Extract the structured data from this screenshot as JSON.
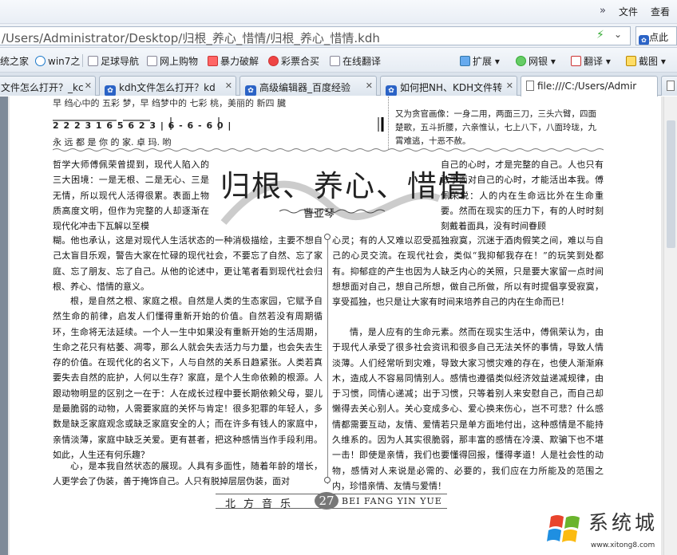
{
  "topbar": {
    "chevron": "»",
    "menu_file": "文件",
    "menu_view": "查看"
  },
  "address": {
    "url": "/Users/Administrator/Desktop/归根_养心_惜情/归根_养心_惜情.kdh",
    "search": "点此"
  },
  "bookmarks": [
    {
      "label": "统之家"
    },
    {
      "label": "win7之"
    },
    {
      "label": "足球导航"
    },
    {
      "label": "网上购物"
    },
    {
      "label": "暴力破解"
    },
    {
      "label": "彩票合买"
    },
    {
      "label": "在线翻译"
    }
  ],
  "tools": {
    "ext": "扩展",
    "bank": "网银",
    "translate": "翻译",
    "screenshot": "截图"
  },
  "tabs": [
    {
      "label": "文件怎么打开？_kc"
    },
    {
      "label": "kdh文件怎么打开？kd"
    },
    {
      "label": "高级编辑器_百度经验"
    },
    {
      "label": "如何把NH、KDH文件转"
    },
    {
      "label": "file:///C:/Users/Admir"
    }
  ],
  "article": {
    "score_cut": "早  绉心中的 五彩    梦，早 绉梦中的 七彩  桃，美丽的 新四  臓",
    "score_notes": "2 2 2 3  1 6 5   6 2 3  | 6 -  6 -  6 0 |",
    "score_lyrics": "永 远 都 是 你      的    家. 卓 玛.   哟",
    "topright_text": "又为贪官画像：一身二用，两面三刀，三头六臂，四面楚歌，五斗折腰，六亲惟认，七上八下，八面玲珑，九霄难逃，十恶不赦。",
    "title": "归根、养心、惜情",
    "author": "曹亚琴",
    "left_top": "哲学大师傅佩荣曾提到，现代人陷入的三大困境：一是无根、二是无心、三是无情，所以现代人活得很累。表面上物质高度文明，但作为完整的人却逐渐在现代化冲击下瓦解以至模",
    "left_main": "糊。他也承认，这是对现代人生活状态的一种消极描绘，主要不想自己太盲目乐观，警告大家在忙碌的现代社会，不要忘了自然、忘了家庭、忘了朋友、忘了自己。从他的论述中，更让笔者看到现代社会归根、养心、惜情的意义。",
    "left_p2": "根，是自然之根、家庭之根。自然是人类的生态家园，它赋予自然生命的前律，启发人们懂得重新开始的价值。自然若没有周期循环，生命将无法延续。一个人一生中如果没有重新开始的生活周期，生命之花只有枯萎、凋零，那么人就会失去活力与力量，也会失去生存的价值。在现代化的名义下，人与自然的关系日趋紧张。人类若真要失去自然的庇护，人何以生存？家庭，是个人生命依赖的根源。人跟动物明显的区别之一在于：人在成长过程中要长期依赖父母，婴儿是最脆弱的动物，人需要家庭的关怀与肯定！很多犯罪的年轻人，多数是缺乏家庭观念或缺乏家庭安全的人；而在许多有钱人的家庭中，亲情淡薄，家庭中缺乏关爱。更有甚者，把这种感情当作手段利用。如此，人生还有何乐趣？",
    "left_p3": "心，是本我自然状态的展现。人具有多面性，随着年龄的增长，人更学会了伪装，善于掩饰自己。人只有脱掉层层伪装，面对",
    "right_top": "自己的心时，才是完整的自己。人也只有敢于面对自己的心时，才能活出本我。傅佩荣说：人的内在生命远比外在生命重要。然而在现实的压力下，有的人时时刻刻戴着面具，没有时间眷顾",
    "right_main": "心灵；有的人又难以忍受孤独寂寞，沉迷于酒肉假笑之间，难以与自己的心灵交流。在现代社会，类似“我抑郁我存在！”的玩笑到处都有。抑郁症的产生也因为人缺乏内心的关照，只是要大家留一点时间想想面对自己，想自己所想，做自己所做，所以有时提倡享受寂寞，享受孤独，也只是让大家有时间来培养自己的内在生命而已！",
    "right_p2": "情，是人应有的生命元素。然而在现实生活中，傅佩荣认为，由于现代人承受了很多社会资讯和很多自己无法关怀的事情，导致人情淡薄。人们经常听到灾难，导致大家习惯灾难的存在，也使人渐渐麻木，造成人不容易同情别人。感情也遵循类似经济效益递减规律，由于习惯，同情心递减；出于习惯，只等着别人来安慰自己，而自己却懒得去关心别人。关心变成多心、爱心换来伤心，岂不可悲？什么感情都需要互动，友情、爱情若只是单方面地付出，这种感情是不能持久维系的。因为人其实很脆弱，那丰富的感情在冷漠、欺骗下也不堪一击！即使是亲情，我们也要懂得回报，懂得孝道！人是社会性的动物，感情对人来说是必需的、必要的，我们应在力所能及的范围之内，珍惜亲情、友情与爱情！",
    "footer_cn": "北方音乐",
    "page_number": "27",
    "footer_en": "BEI FANG YIN YUE"
  },
  "watermark": {
    "text": "系统城",
    "site": "www.xitong8.com"
  }
}
